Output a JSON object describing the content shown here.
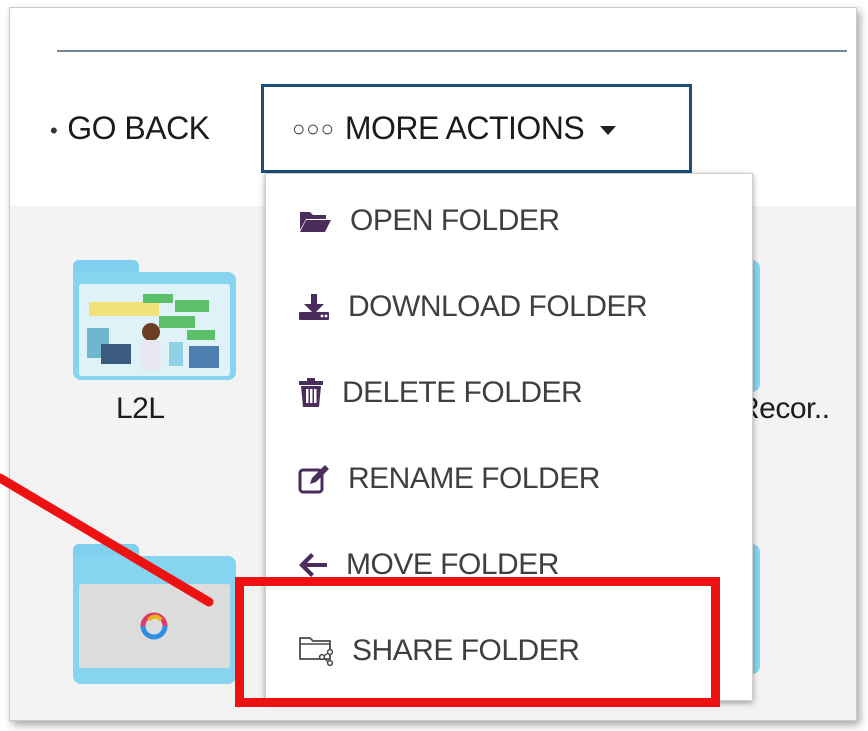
{
  "toolbar": {
    "go_back_label": "GO BACK",
    "more_actions_dots": "○○○",
    "more_actions_label": "MORE ACTIONS"
  },
  "menu": {
    "items": [
      {
        "label": "OPEN FOLDER",
        "icon": "folder-open-icon"
      },
      {
        "label": "DOWNLOAD FOLDER",
        "icon": "download-icon"
      },
      {
        "label": "DELETE FOLDER",
        "icon": "trash-icon"
      },
      {
        "label": "RENAME FOLDER",
        "icon": "edit-icon"
      },
      {
        "label": "MOVE FOLDER",
        "icon": "arrow-left-icon"
      },
      {
        "label": "SHARE FOLDER",
        "icon": "share-folder-icon"
      }
    ]
  },
  "folders": [
    {
      "name": "L2L"
    },
    {
      "name": "Recor.."
    }
  ],
  "colors": {
    "accent_border": "#1b4e7a",
    "folder": "#87d4f0",
    "highlight": "#ee1111",
    "menu_icon": "#4a2d5c"
  }
}
